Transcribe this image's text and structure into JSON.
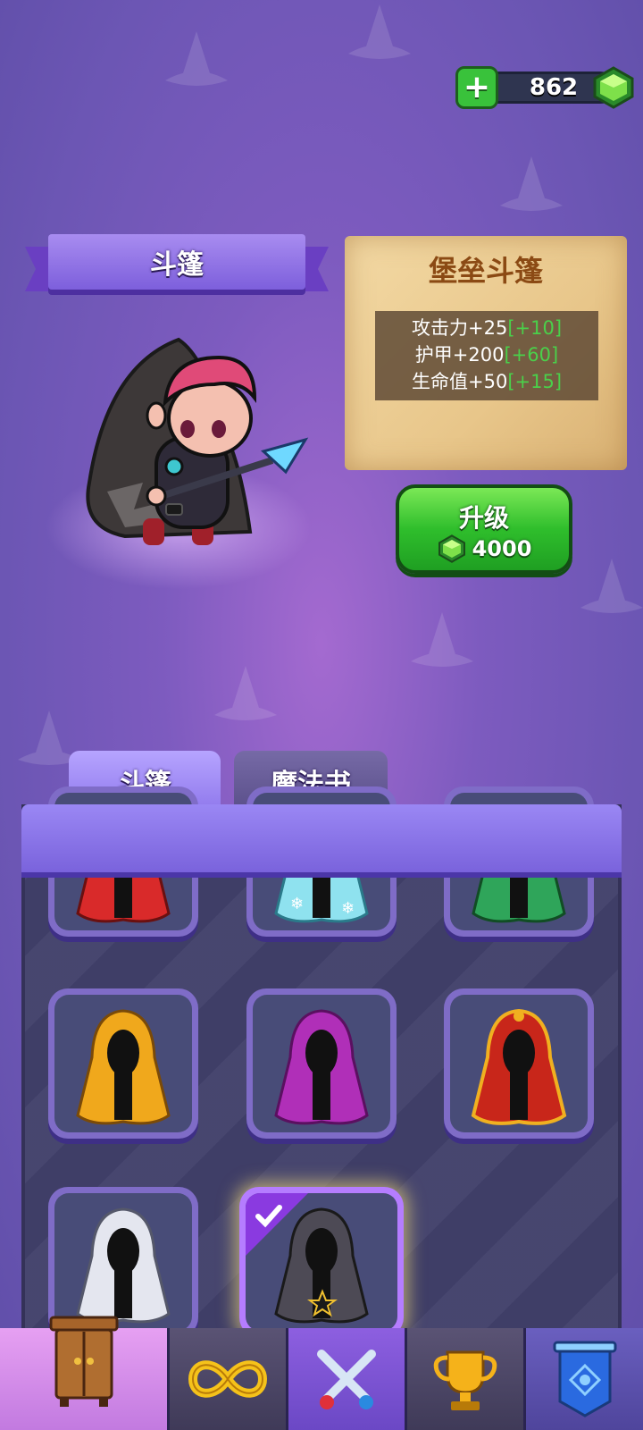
{
  "currency": {
    "amount": "862",
    "add_icon": "plus-icon",
    "gem_icon": "gem-icon"
  },
  "hero": {
    "ribbon_title": "斗篷"
  },
  "item_info": {
    "name": "堡垒斗篷",
    "stats": [
      {
        "label": "攻击力+25",
        "bonus": "[+10]"
      },
      {
        "label": "护甲+200",
        "bonus": "[+60]"
      },
      {
        "label": "生命值+50",
        "bonus": "[+15]"
      }
    ],
    "bonus_color": "#4ad04a"
  },
  "upgrade": {
    "label": "升级",
    "cost": "4000"
  },
  "tabs": [
    {
      "label": "斗篷"
    },
    {
      "label": "魔法书"
    }
  ],
  "cloaks": [
    {
      "name": "red-cloak",
      "color": "#d92a2a"
    },
    {
      "name": "ice-cloak",
      "color": "#8fe2ef"
    },
    {
      "name": "green-cloak",
      "color": "#2fa55a"
    },
    {
      "name": "gold-cloak",
      "color": "#f0a81c"
    },
    {
      "name": "purple-cloak",
      "color": "#b02fb8"
    },
    {
      "name": "royal-red-cloak",
      "color": "#c8261a"
    },
    {
      "name": "white-cloak",
      "color": "#e4e6ef"
    },
    {
      "name": "fortress-cloak",
      "color": "#4d4a55",
      "equipped": true
    }
  ],
  "nav": [
    {
      "name": "wardrobe-icon"
    },
    {
      "name": "infinity-icon"
    },
    {
      "name": "crossed-swords-icon"
    },
    {
      "name": "trophy-icon"
    },
    {
      "name": "guild-banner-icon"
    }
  ]
}
